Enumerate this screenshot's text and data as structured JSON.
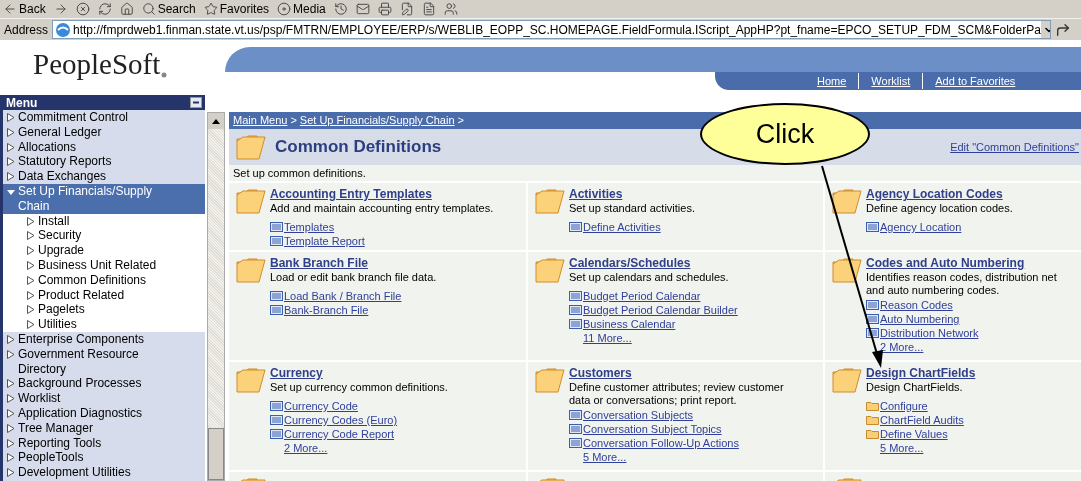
{
  "toolbar": {
    "buttons": [
      {
        "kind": "back",
        "label": "Back"
      },
      {
        "kind": "forward"
      },
      {
        "kind": "stop"
      },
      {
        "kind": "refresh"
      },
      {
        "kind": "home"
      },
      {
        "kind": "search",
        "label": "Search"
      },
      {
        "kind": "favorites",
        "label": "Favorites"
      },
      {
        "kind": "media",
        "label": "Media"
      },
      {
        "kind": "history"
      },
      {
        "kind": "mail"
      },
      {
        "kind": "print"
      },
      {
        "kind": "edit"
      },
      {
        "kind": "discuss"
      },
      {
        "kind": "messenger"
      }
    ]
  },
  "address": {
    "label": "Address",
    "url": "http://fmprdweb1.finman.state.vt.us/psp/FMTRN/EMPLOYEE/ERP/s/WEBLIB_EOPP_SC.HOMEPAGE.FieldFormula.IScript_AppHP?pt_fname=EPCO_SETUP_FDM_SCM&FolderPa"
  },
  "header": {
    "logo": "PeopleSoft",
    "nav": [
      "Home",
      "Worklist",
      "Add to Favorites"
    ]
  },
  "menu": {
    "title": "Menu",
    "items": [
      {
        "label": "Commitment Control",
        "expanded": false,
        "selected": false
      },
      {
        "label": "General Ledger",
        "expanded": false,
        "selected": false
      },
      {
        "label": "Allocations",
        "expanded": false,
        "selected": false
      },
      {
        "label": "Statutory Reports",
        "expanded": false,
        "selected": false
      },
      {
        "label": "Data Exchanges",
        "expanded": false,
        "selected": false
      },
      {
        "label": "Set Up Financials/Supply Chain",
        "expanded": true,
        "selected": true,
        "children": [
          {
            "label": "Install",
            "expanded": false,
            "selected": false
          },
          {
            "label": "Security",
            "expanded": false,
            "selected": false
          },
          {
            "label": "Upgrade",
            "expanded": false,
            "selected": false
          },
          {
            "label": "Business Unit Related",
            "expanded": false,
            "selected": false
          },
          {
            "label": "Common Definitions",
            "expanded": false,
            "selected": false
          },
          {
            "label": "Product Related",
            "expanded": false,
            "selected": false
          },
          {
            "label": "Pagelets",
            "expanded": false,
            "selected": false
          },
          {
            "label": "Utilities",
            "expanded": false,
            "selected": false
          }
        ]
      },
      {
        "label": "Enterprise Components",
        "expanded": false,
        "selected": false
      },
      {
        "label": "Government Resource Directory",
        "expanded": false,
        "selected": false
      },
      {
        "label": "Background Processes",
        "expanded": false,
        "selected": false
      },
      {
        "label": "Worklist",
        "expanded": false,
        "selected": false
      },
      {
        "label": "Application Diagnostics",
        "expanded": false,
        "selected": false
      },
      {
        "label": "Tree Manager",
        "expanded": false,
        "selected": false
      },
      {
        "label": "Reporting Tools",
        "expanded": false,
        "selected": false
      },
      {
        "label": "PeopleTools",
        "expanded": false,
        "selected": false
      },
      {
        "label": "Development Utilities",
        "expanded": false,
        "selected": false
      }
    ]
  },
  "content": {
    "breadcrumb": [
      "Main Menu",
      "Set Up Financials/Supply Chain"
    ],
    "separator": ">",
    "title": "Common Definitions",
    "edit_link": "Edit \"Common Definitions\"",
    "description": "Set up common definitions.",
    "sections": [
      {
        "title": "Accounting Entry Templates",
        "description": [
          "Add and maintain accounting entry templates."
        ],
        "links": [
          {
            "kind": "component",
            "label": "Templates"
          },
          {
            "kind": "component",
            "label": "Template Report"
          }
        ]
      },
      {
        "title": "Activities",
        "description": [
          "Set up standard activities."
        ],
        "links": [
          {
            "kind": "component",
            "label": "Define Activities"
          }
        ]
      },
      {
        "title": "Agency Location Codes",
        "description": [
          "Define agency location codes."
        ],
        "links": [
          {
            "kind": "component",
            "label": "Agency Location"
          }
        ]
      },
      {
        "title": "Bank Branch File",
        "description": [
          "Load or edit bank branch file data."
        ],
        "links": [
          {
            "kind": "component",
            "label": "Load Bank / Branch File"
          },
          {
            "kind": "component",
            "label": "Bank-Branch File"
          }
        ]
      },
      {
        "title": "Calendars/Schedules",
        "description": [
          "Set up calendars and schedules."
        ],
        "links": [
          {
            "kind": "component",
            "label": "Budget Period Calendar"
          },
          {
            "kind": "component",
            "label": "Budget Period Calendar Builder"
          },
          {
            "kind": "component",
            "label": "Business Calendar"
          }
        ],
        "more": "11 More..."
      },
      {
        "title": "Codes and Auto Numbering",
        "description": [
          "Identifies reason codes, distribution net",
          "and auto numbering codes."
        ],
        "links": [
          {
            "kind": "component",
            "label": "Reason Codes"
          },
          {
            "kind": "component",
            "label": "Auto Numbering"
          },
          {
            "kind": "component",
            "label": "Distribution Network"
          }
        ],
        "more": "2 More..."
      },
      {
        "title": "Currency",
        "description": [
          "Set up currency common definitions."
        ],
        "links": [
          {
            "kind": "component",
            "label": "Currency Code"
          },
          {
            "kind": "component",
            "label": "Currency Codes (Euro)"
          },
          {
            "kind": "component",
            "label": "Currency Code Report"
          }
        ],
        "more": "2 More..."
      },
      {
        "title": "Customers",
        "description": [
          "Define customer attributes; review customer",
          "data or conversations; print report."
        ],
        "links": [
          {
            "kind": "component",
            "label": "Conversation Subjects"
          },
          {
            "kind": "component",
            "label": "Conversation Subject Topics"
          },
          {
            "kind": "component",
            "label": "Conversation Follow-Up Actions"
          }
        ],
        "more": "5 More..."
      },
      {
        "title": "Design ChartFields",
        "description": [
          "Design ChartFields."
        ],
        "links": [
          {
            "kind": "folder",
            "label": "Configure"
          },
          {
            "kind": "folder",
            "label": "ChartField Audits"
          },
          {
            "kind": "folder",
            "label": "Define Values"
          }
        ],
        "more": "5 More..."
      }
    ]
  },
  "callout": {
    "text": "Click"
  }
}
